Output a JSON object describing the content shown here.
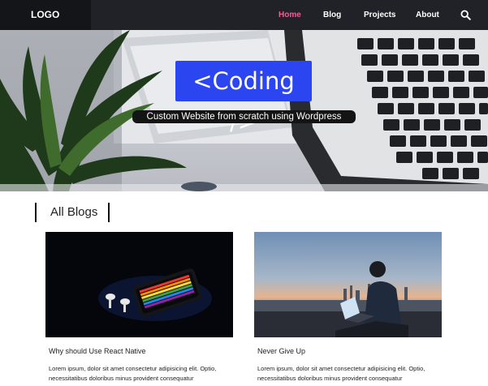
{
  "nav": {
    "logo": "LOGO",
    "links": [
      {
        "label": "Home",
        "active": true
      },
      {
        "label": "Blog",
        "active": false
      },
      {
        "label": "Projects",
        "active": false
      },
      {
        "label": "About",
        "active": false
      }
    ],
    "search_icon": "search-icon",
    "active_color": "#f35c9a"
  },
  "hero": {
    "title": "<Coding />",
    "subtitle": "Custom Website from scratch using Wordpress",
    "accent": "#2b45f0"
  },
  "blogs": {
    "heading": "All Blogs",
    "posts": [
      {
        "title": "Why should Use React Native",
        "excerpt": "Lorem ipsum, dolor sit amet consectetur adipisicing elit. Optio, necessitatibus doloribus minus provident consequatur"
      },
      {
        "title": "Never Give Up",
        "excerpt": "Lorem ipsum, dolor sit amet consectetur adipisicing elit. Optio, necessitatibus doloribus minus provident consequatur"
      }
    ]
  }
}
